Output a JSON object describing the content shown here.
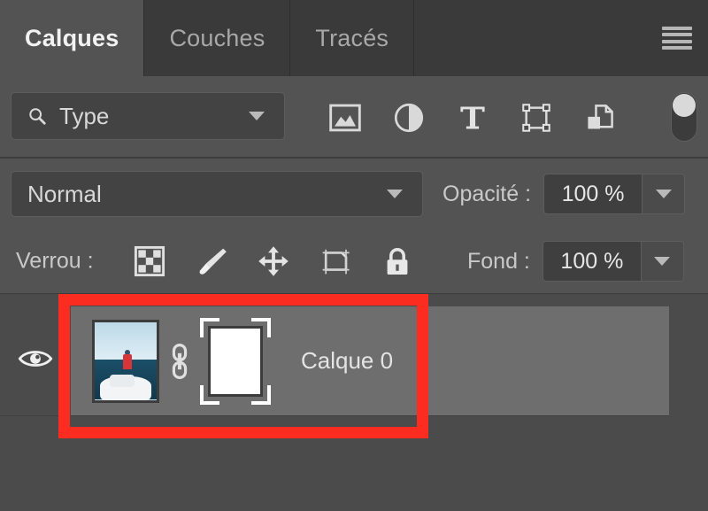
{
  "panel": {
    "title": "Calques",
    "tabs": [
      {
        "label": "Calques",
        "active": true
      },
      {
        "label": "Couches",
        "active": false
      },
      {
        "label": "Tracés",
        "active": false
      }
    ],
    "menu_icon": "hamburger-menu-icon"
  },
  "filter": {
    "search_icon": "search-icon",
    "type_label": "Type",
    "caret_icon": "chevron-down-icon",
    "icons": [
      {
        "name": "filter-pixel-layers-icon",
        "title": "Pixels"
      },
      {
        "name": "filter-adjustment-layers-icon",
        "title": "Réglage"
      },
      {
        "name": "filter-type-layers-icon",
        "title": "Texte"
      },
      {
        "name": "filter-shape-layers-icon",
        "title": "Forme"
      },
      {
        "name": "filter-smart-object-layers-icon",
        "title": "Objet dynamique"
      }
    ],
    "toggle": {
      "name": "filter-enable-toggle",
      "state": "on"
    }
  },
  "blend": {
    "mode": "Normal",
    "caret_icon": "chevron-down-icon",
    "opacity_label": "Opacité :",
    "opacity_value": "100 %"
  },
  "lock": {
    "caption": "Verrou :",
    "icons": [
      {
        "name": "lock-transparent-pixels-icon"
      },
      {
        "name": "lock-image-pixels-icon"
      },
      {
        "name": "lock-position-icon"
      },
      {
        "name": "lock-artboard-nesting-icon"
      },
      {
        "name": "lock-all-icon"
      }
    ],
    "fill_label": "Fond :",
    "fill_value": "100 %"
  },
  "layers": [
    {
      "name": "Calque 0",
      "visible": true,
      "selected": true,
      "linked": true,
      "mask_selected": true,
      "thumbnail": "photo-boat-ocean-thumbnail",
      "mask_thumbnail": "white-layer-mask-thumbnail"
    }
  ],
  "annotation": {
    "shape": "rectangle",
    "color": "#fc2d20"
  },
  "colors": {
    "panel_bg": "#4b4b4b",
    "row_bg": "#535353",
    "tab_inactive_bg": "#3a3a3a",
    "tab_active_bg": "#535353",
    "selected_layer_bg": "#6e6e6e",
    "text": "#d8d8d8",
    "accent_red": "#fc2d20"
  }
}
